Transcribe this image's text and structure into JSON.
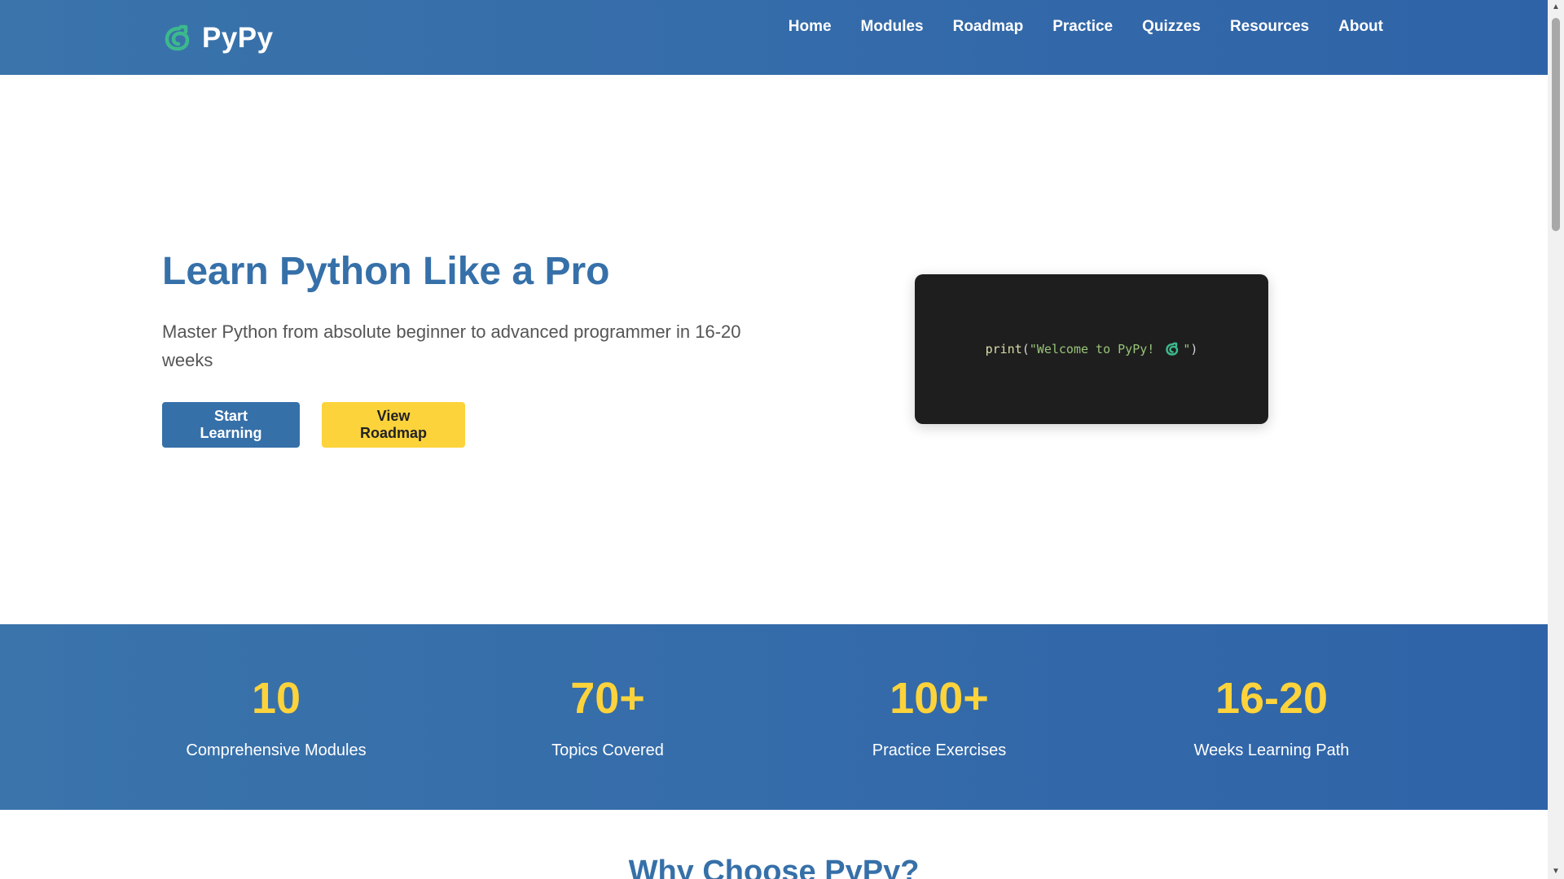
{
  "brand": {
    "name": "PyPy",
    "icon": "python-snake-icon"
  },
  "nav": {
    "items": [
      {
        "label": "Home"
      },
      {
        "label": "Modules"
      },
      {
        "label": "Roadmap"
      },
      {
        "label": "Practice"
      },
      {
        "label": "Quizzes"
      },
      {
        "label": "Resources"
      },
      {
        "label": "About"
      }
    ]
  },
  "hero": {
    "title": "Learn Python Like a Pro",
    "subtitle": "Master Python from absolute beginner to advanced programmer in 16-20 weeks",
    "primary_button": "Start Learning",
    "secondary_button": "View Roadmap",
    "code": {
      "fn": "print",
      "open": "(",
      "string_start": "\"Welcome to PyPy! ",
      "emoji": "python-snake-icon",
      "string_end": "\"",
      "close": ")"
    }
  },
  "stats": [
    {
      "value": "10",
      "label": "Comprehensive Modules"
    },
    {
      "value": "70+",
      "label": "Topics Covered"
    },
    {
      "value": "100+",
      "label": "Practice Exercises"
    },
    {
      "value": "16-20",
      "label": "Weeks Learning Path"
    }
  ],
  "section": {
    "title": "Why Choose PyPy?"
  },
  "colors": {
    "primary": "#3670a9",
    "accent": "#fdd33b",
    "code_bg": "#1e1e1e",
    "snake_icon": "#3cb98c"
  }
}
